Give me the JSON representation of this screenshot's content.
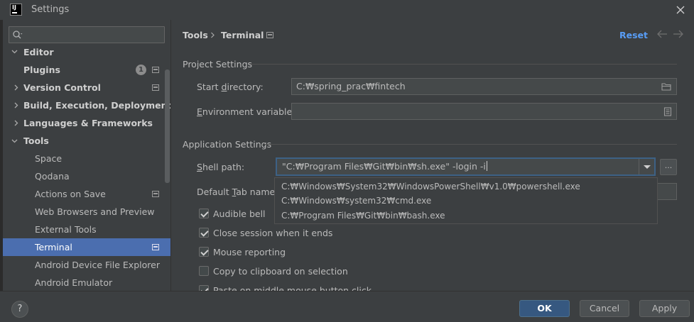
{
  "window": {
    "title": "Settings"
  },
  "search": {
    "placeholder": "",
    "value": ""
  },
  "sidebar": {
    "items": [
      {
        "label": "Editor",
        "expandable": true,
        "expanded": true
      },
      {
        "label": "Plugins",
        "badge": "1",
        "config_icon": true
      },
      {
        "label": "Version Control",
        "expandable": true,
        "config_icon": true
      },
      {
        "label": "Build, Execution, Deployment",
        "expandable": true
      },
      {
        "label": "Languages & Frameworks",
        "expandable": true
      },
      {
        "label": "Tools",
        "expandable": true,
        "expanded": true
      },
      {
        "label": "Space"
      },
      {
        "label": "Qodana"
      },
      {
        "label": "Actions on Save",
        "config_icon": true
      },
      {
        "label": "Web Browsers and Preview"
      },
      {
        "label": "External Tools"
      },
      {
        "label": "Terminal",
        "selected": true,
        "config_icon": true
      },
      {
        "label": "Android Device File Explorer"
      },
      {
        "label": "Android Emulator"
      }
    ]
  },
  "header": {
    "breadcrumb": [
      "Tools",
      "Terminal"
    ],
    "reset_label": "Reset"
  },
  "project_settings": {
    "title": "Project Settings",
    "start_directory_label_pre": "Start ",
    "start_directory_label_u": "d",
    "start_directory_label_post": "irectory:",
    "start_directory_value": "C:₩spring_prac₩fintech",
    "env_vars_label_u": "E",
    "env_vars_label_post": "nvironment variables:",
    "env_vars_value": ""
  },
  "application_settings": {
    "title": "Application Settings",
    "shell_path_label_u": "S",
    "shell_path_label_post": "hell path:",
    "shell_path_value": "\"C:₩Program Files₩Git₩bin₩sh.exe\" -login -i",
    "shell_browse_label": "...",
    "default_tab_label_pre": "Default ",
    "default_tab_label_u": "T",
    "default_tab_label_post": "ab name:",
    "shell_options": [
      "C:₩Windows₩System32₩WindowsPowerShell₩v1.0₩powershell.exe",
      "C:₩Windows₩system32₩cmd.exe",
      "C:₩Program Files₩Git₩bin₩bash.exe"
    ],
    "checkboxes": [
      {
        "label": "Audible bell",
        "checked": true
      },
      {
        "label": "Close session when it ends",
        "checked": true
      },
      {
        "label": "Mouse reporting",
        "checked": true
      },
      {
        "label": "Copy to clipboard on selection",
        "checked": false
      },
      {
        "label": "Paste on middle mouse button click",
        "checked": true
      }
    ]
  },
  "footer": {
    "help_label": "?",
    "ok_label": "OK",
    "cancel_label": "Cancel",
    "apply_label": "Apply"
  },
  "colors": {
    "background": "#3c3f41",
    "selection": "#4b6eaf",
    "link": "#589df6",
    "primary_button": "#365880"
  }
}
